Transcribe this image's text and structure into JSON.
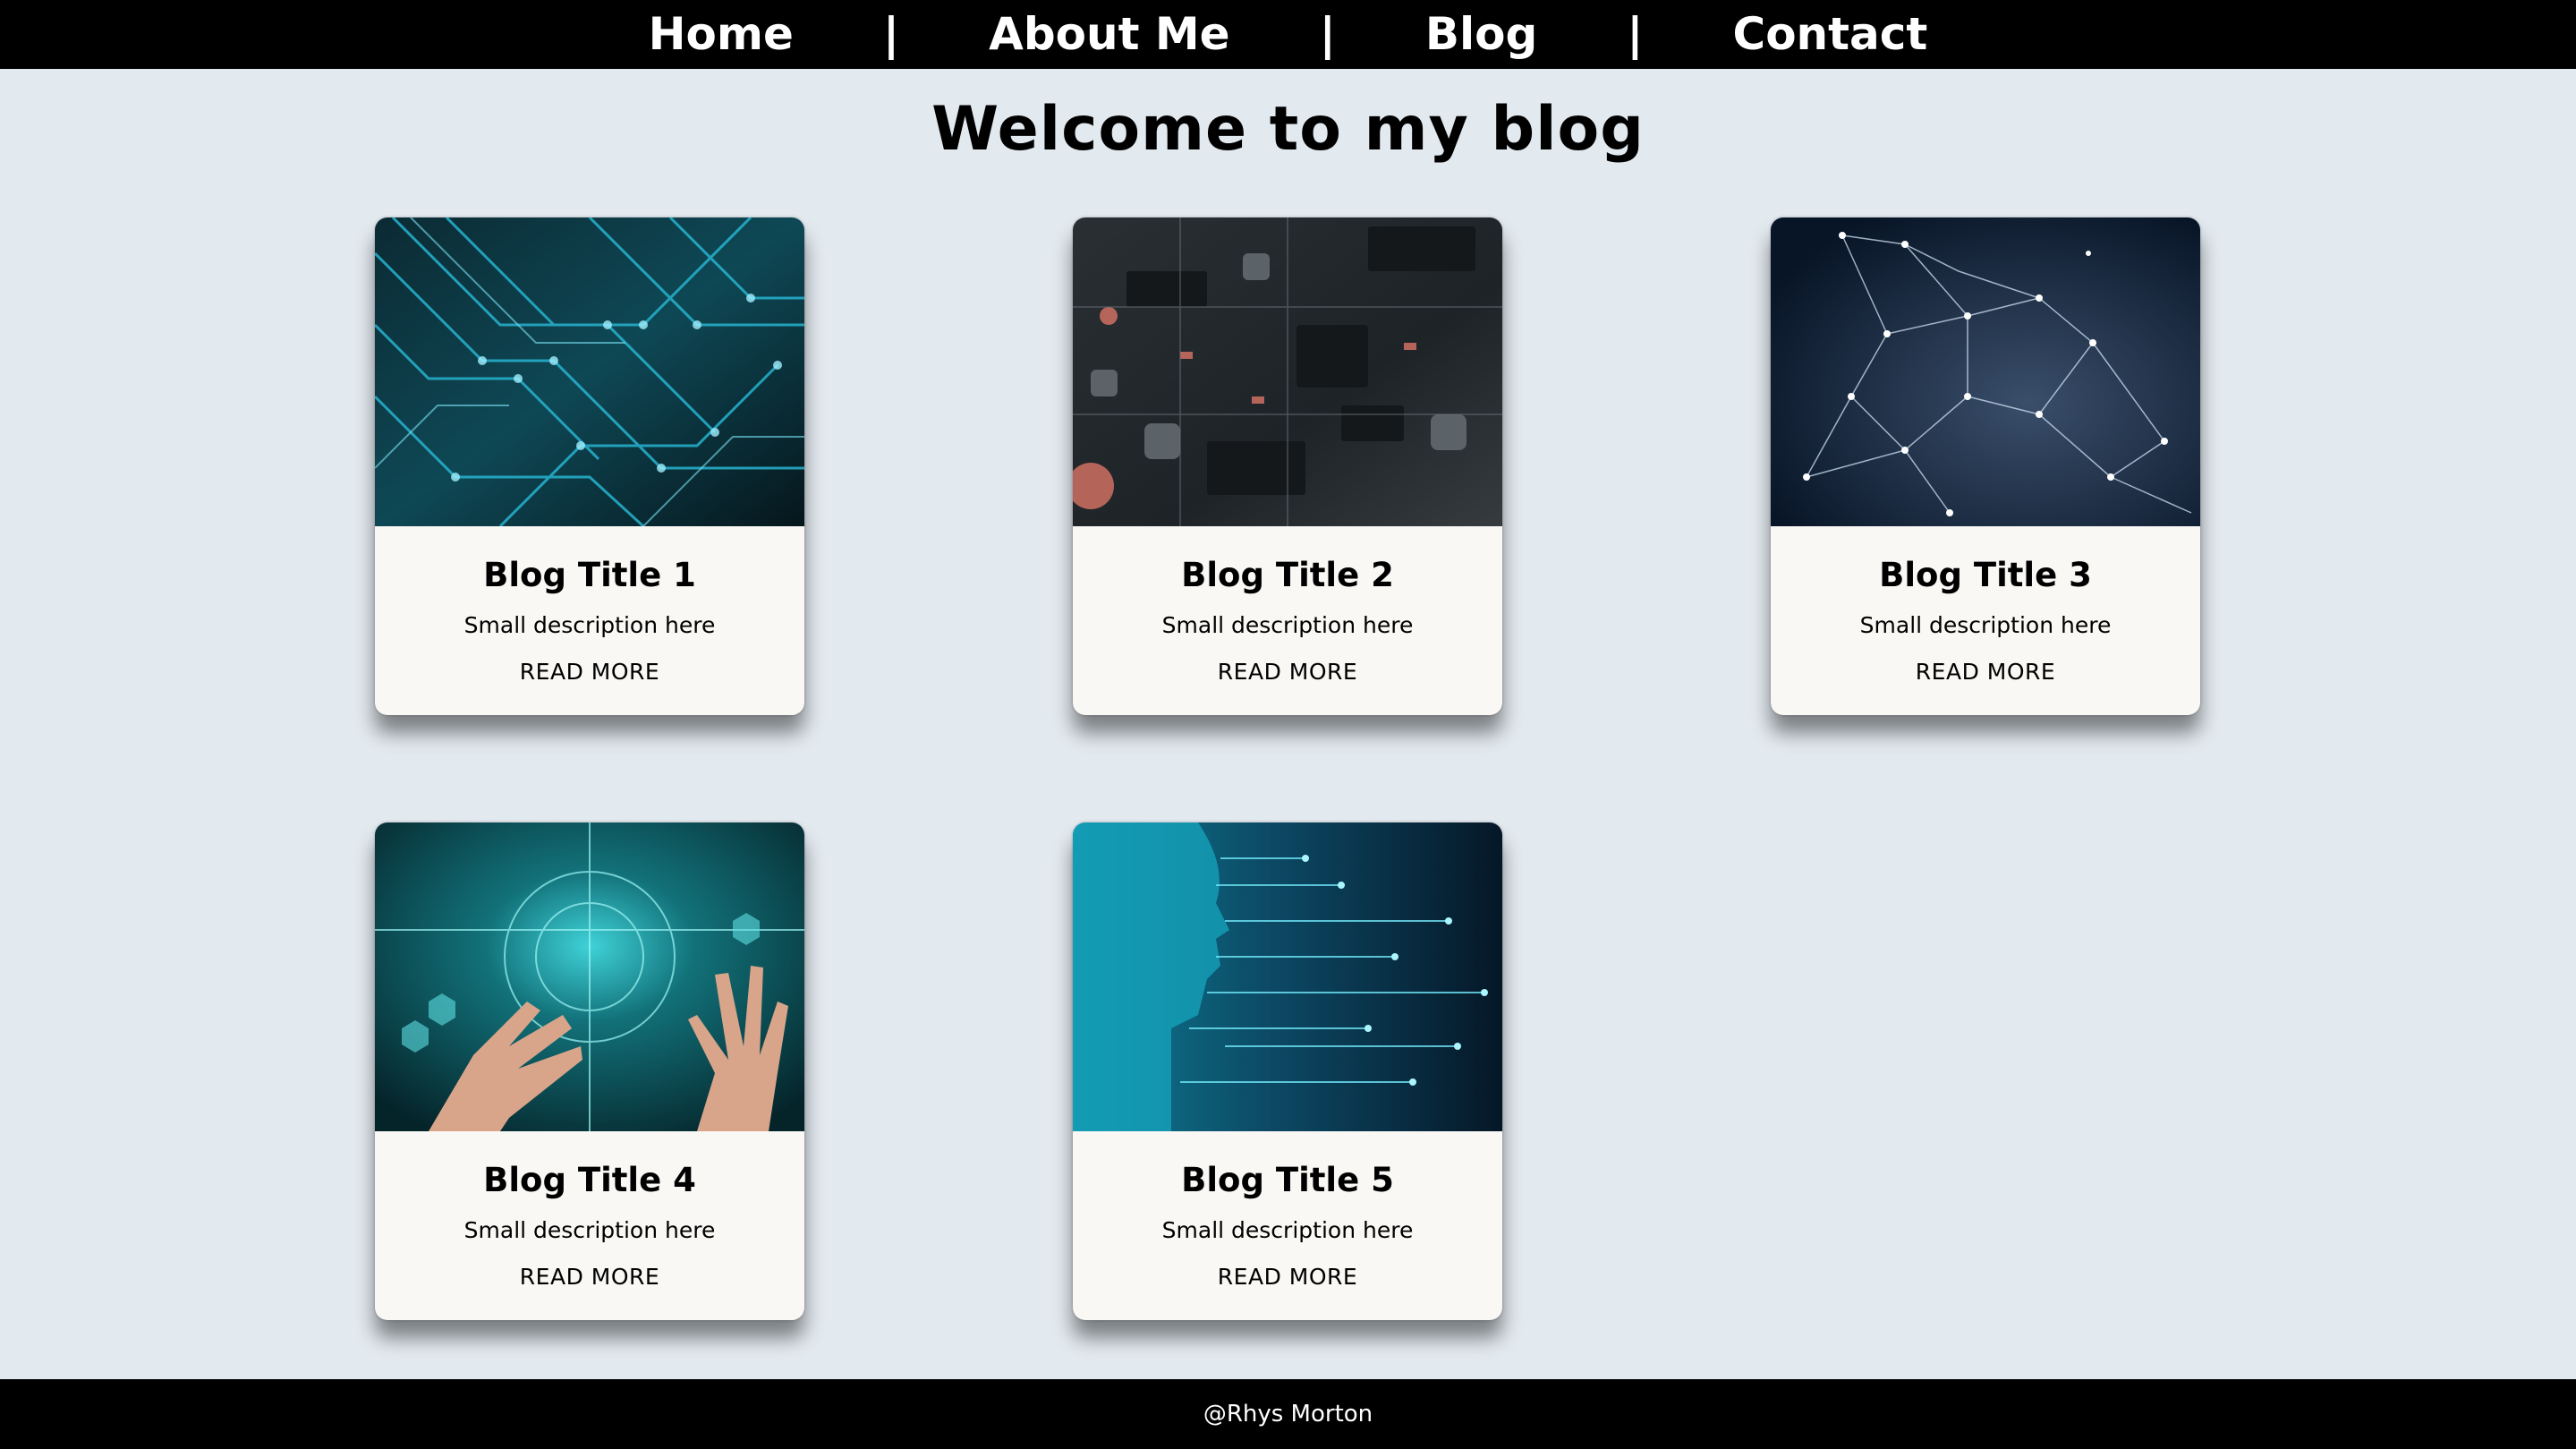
{
  "nav": {
    "items": [
      {
        "label": "Home"
      },
      {
        "label": "About Me"
      },
      {
        "label": "Blog"
      },
      {
        "label": "Contact"
      }
    ],
    "separator": "|"
  },
  "main": {
    "title": "Welcome to my blog",
    "cards": [
      {
        "title": "Blog Title 1",
        "description": "Small description here",
        "link": "READ MORE",
        "image_icon": "circuit-board-image"
      },
      {
        "title": "Blog Title 2",
        "description": "Small description here",
        "link": "READ MORE",
        "image_icon": "motherboard-image"
      },
      {
        "title": "Blog Title 3",
        "description": "Small description here",
        "link": "READ MORE",
        "image_icon": "network-mesh-image"
      },
      {
        "title": "Blog Title 4",
        "description": "Small description here",
        "link": "READ MORE",
        "image_icon": "hands-digital-image"
      },
      {
        "title": "Blog Title 5",
        "description": "Small description here",
        "link": "READ MORE",
        "image_icon": "ai-head-image"
      }
    ]
  },
  "footer": {
    "text": "@Rhys Morton"
  },
  "colors": {
    "background": "#e2e9ef",
    "nav": "#000000",
    "card": "#f9f8f5",
    "footer": "#000000"
  }
}
